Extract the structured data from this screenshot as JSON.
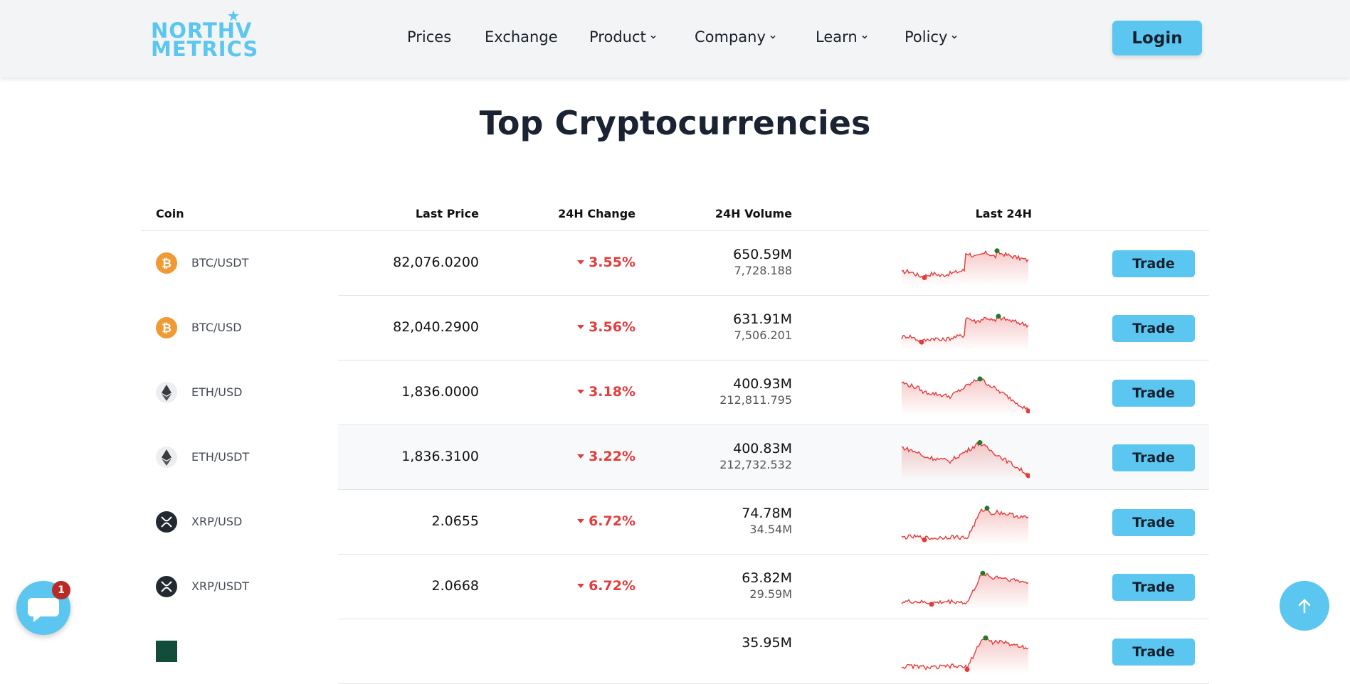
{
  "header": {
    "logo_line1": "NORTHV",
    "logo_line2": "METRICS",
    "nav": [
      {
        "label": "Prices",
        "dropdown": false
      },
      {
        "label": "Exchange",
        "dropdown": false
      },
      {
        "label": "Product",
        "dropdown": true
      },
      {
        "label": "Company",
        "dropdown": true
      },
      {
        "label": "Learn",
        "dropdown": true
      },
      {
        "label": "Policy",
        "dropdown": true
      }
    ],
    "login_label": "Login"
  },
  "page": {
    "title": "Top Cryptocurrencies"
  },
  "table": {
    "headers": {
      "coin": "Coin",
      "last_price": "Last Price",
      "change": "24H Change",
      "volume": "24H Volume",
      "last24": "Last 24H"
    },
    "trade_label": "Trade",
    "rows": [
      {
        "pair": "BTC/USDT",
        "icon": "bitcoin-icon",
        "price": "82,076.0200",
        "change": "3.55%",
        "volume": "650.59M",
        "volume_sub": "7,728.188",
        "shape": "btc"
      },
      {
        "pair": "BTC/USD",
        "icon": "bitcoin-icon",
        "price": "82,040.2900",
        "change": "3.56%",
        "volume": "631.91M",
        "volume_sub": "7,506.201",
        "shape": "btc"
      },
      {
        "pair": "ETH/USD",
        "icon": "ethereum-icon",
        "price": "1,836.0000",
        "change": "3.18%",
        "volume": "400.93M",
        "volume_sub": "212,811.795",
        "shape": "eth"
      },
      {
        "pair": "ETH/USDT",
        "icon": "ethereum-icon",
        "price": "1,836.3100",
        "change": "3.22%",
        "volume": "400.83M",
        "volume_sub": "212,732.532",
        "shape": "eth"
      },
      {
        "pair": "XRP/USD",
        "icon": "xrp-icon",
        "price": "2.0655",
        "change": "6.72%",
        "volume": "74.78M",
        "volume_sub": "34.54M",
        "shape": "xrp"
      },
      {
        "pair": "XRP/USDT",
        "icon": "xrp-icon",
        "price": "2.0668",
        "change": "6.72%",
        "volume": "63.82M",
        "volume_sub": "29.59M",
        "shape": "xrp"
      },
      {
        "pair": "",
        "icon": "coin-icon",
        "price": "",
        "change": "",
        "volume": "35.95M",
        "volume_sub": "",
        "shape": "xrp"
      }
    ]
  },
  "chat": {
    "badge": "1"
  },
  "colors": {
    "accent": "#5bc6ef",
    "negative": "#e23d3d",
    "high_marker": "#1f7a2a",
    "low_marker": "#e23d3d"
  }
}
